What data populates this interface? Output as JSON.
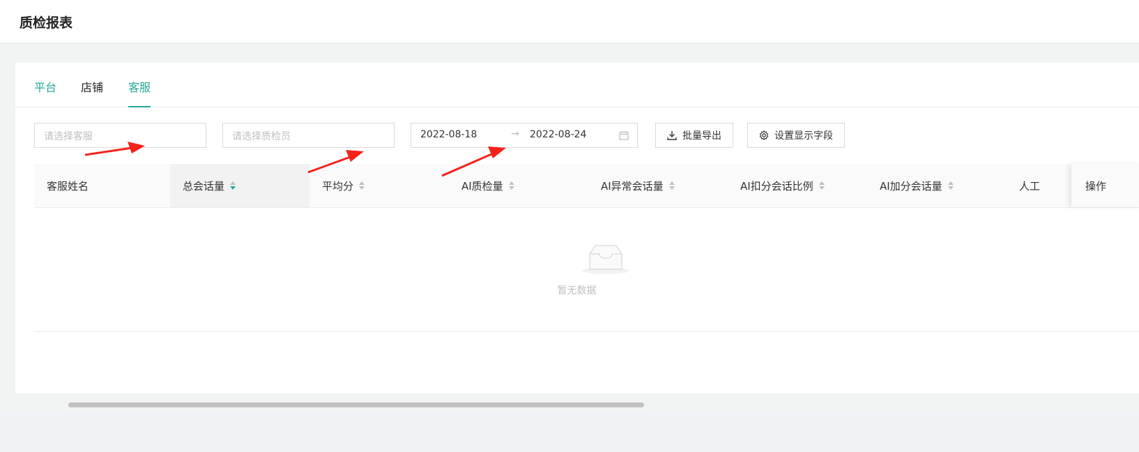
{
  "header": {
    "title": "质检报表"
  },
  "tabs": [
    {
      "label": "平台"
    },
    {
      "label": "店铺"
    },
    {
      "label": "客服"
    }
  ],
  "filters": {
    "agent_placeholder": "请选择客服",
    "inspector_placeholder": "请选择质检员",
    "date_start": "2022-08-18",
    "date_arrow": "→",
    "date_end": "2022-08-24"
  },
  "buttons": {
    "export_label": "批量导出",
    "settings_label": "设置显示字段"
  },
  "table": {
    "columns": [
      {
        "label": "客服姓名"
      },
      {
        "label": "总会话量"
      },
      {
        "label": "平均分"
      },
      {
        "label": "AI质检量"
      },
      {
        "label": "AI异常会话量"
      },
      {
        "label": "AI扣分会话比例"
      },
      {
        "label": "AI加分会话量"
      },
      {
        "label": "人工"
      }
    ],
    "operation_label": "操作",
    "empty_text": "暂无数据"
  },
  "colors": {
    "accent": "#26a69a",
    "arrow": "#f5221c"
  },
  "icons": [
    "download-icon",
    "gear-icon",
    "calendar-icon",
    "empty-inbox-icon",
    "sort-icon"
  ]
}
